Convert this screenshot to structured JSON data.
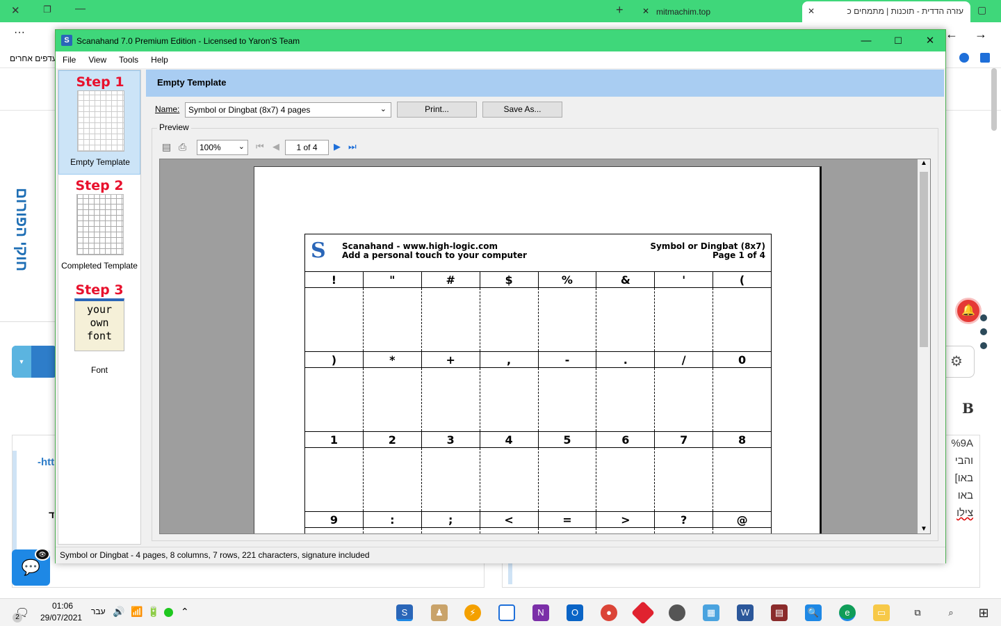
{
  "browser": {
    "tab_active": "עזרה הדדית - תוכנות | מתמחים כ",
    "tab_2": "mitmachim.top",
    "bookmarks_text": "עדפים אחרים",
    "colors": {
      "chrome": "#3fd77a"
    }
  },
  "web": {
    "vertical_text": "חוקי הפורום",
    "right_text": [
      "%9A",
      "והבי",
      "[באו",
      "באו",
      "צילו"
    ],
    "left_text_1": "-htt",
    "left_text_2": "ד",
    "big_B": "B"
  },
  "app": {
    "title": "Scanahand 7.0 Premium Edition - Licensed to Yaron'S Team",
    "menu": [
      "File",
      "View",
      "Tools",
      "Help"
    ],
    "steps": [
      {
        "title": "Step 1",
        "label": "Empty Template",
        "selected": true
      },
      {
        "title": "Step 2",
        "label": "Completed Template",
        "selected": false
      },
      {
        "title": "Step 3",
        "label": "Font",
        "selected": false
      }
    ],
    "step3_font_lines": [
      "your",
      "own",
      "font"
    ],
    "header": "Empty Template",
    "name_label": "Name:",
    "name_value": "Symbol or Dingbat (8x7) 4 pages",
    "print_button": "Print...",
    "save_as_button": "Save As...",
    "preview_label": "Preview",
    "zoom": "100%",
    "page": "1 of 4",
    "status": "Symbol or Dingbat - 4 pages, 8 columns, 7 rows, 221 characters, signature included"
  },
  "template": {
    "line1": "Scanahand - www.high-logic.com",
    "line2": "Add a personal touch to your computer",
    "right1": "Symbol or Dingbat (8x7)",
    "right2": "Page 1 of 4",
    "rows": [
      [
        "!",
        "\"",
        "#",
        "$",
        "%",
        "&",
        "'",
        "("
      ],
      [
        ")",
        "*",
        "+",
        ",",
        "-",
        ".",
        "/",
        "0"
      ],
      [
        "1",
        "2",
        "3",
        "4",
        "5",
        "6",
        "7",
        "8"
      ],
      [
        "9",
        ":",
        ";",
        "<",
        "=",
        ">",
        "?",
        "@"
      ]
    ]
  },
  "taskbar": {
    "time": "01:06",
    "date": "29/07/2021",
    "lang": "עבר",
    "notification_count": "2"
  }
}
